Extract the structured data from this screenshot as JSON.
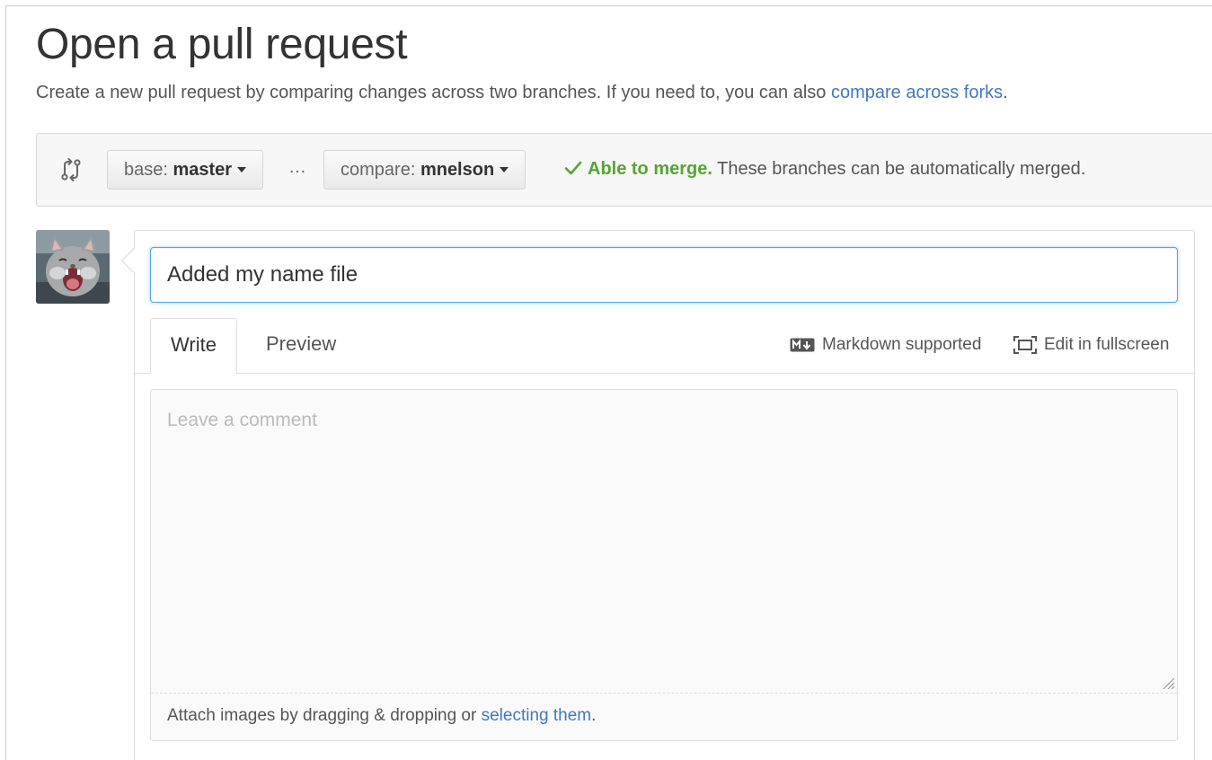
{
  "header": {
    "title": "Open a pull request",
    "subtitle_text": "Create a new pull request by comparing changes across two branches. If you need to, you can also ",
    "subtitle_link": "compare across forks",
    "subtitle_end": "."
  },
  "range": {
    "base_prefix": "base: ",
    "base_branch": "master",
    "ellipsis": "…",
    "compare_prefix": "compare: ",
    "compare_branch": "mnelson",
    "merge_status": "Able to merge.",
    "merge_message": " These branches can be automatically merged."
  },
  "form": {
    "title_value": "Added my name file",
    "tabs": [
      {
        "label": "Write",
        "active": true
      },
      {
        "label": "Preview",
        "active": false
      }
    ],
    "markdown_label": "Markdown supported",
    "fullscreen_label": "Edit in fullscreen",
    "comment_placeholder": "Leave a comment",
    "attach_text": "Attach images by dragging & dropping or ",
    "attach_link": "selecting them",
    "attach_end": "."
  },
  "colors": {
    "link": "#4078c0",
    "merge_ok": "#55a532",
    "focus_border": "#51a7e8"
  },
  "icons": [
    "git-compare-icon",
    "check-icon",
    "markdown-icon",
    "fullscreen-icon",
    "avatar-cat"
  ]
}
